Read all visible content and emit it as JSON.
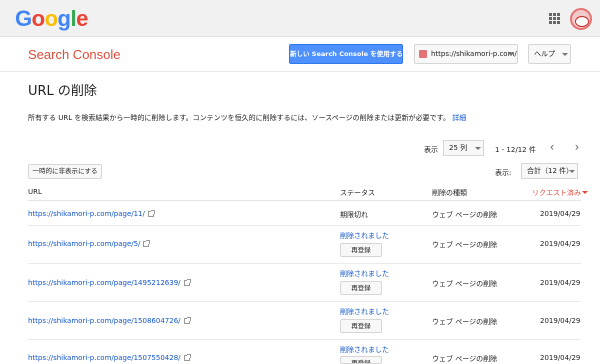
{
  "header": {
    "logo_letters": [
      "G",
      "o",
      "o",
      "g",
      "l",
      "e"
    ],
    "apps_icon": "apps-grid-icon",
    "avatar_icon": "user-avatar"
  },
  "brandbar": {
    "brand": "Search Console",
    "new_console_button": "新しい Search Console を使用する",
    "site": "https://shikamori-p.com/",
    "help": "ヘルプ"
  },
  "page": {
    "title": "URL の削除",
    "description": "所有する URL を検索結果から一時的に削除します。コンテンツを恒久的に削除するには、ソースページの削除または更新が必要です。",
    "details_link": "詳細"
  },
  "pager": {
    "label": "表示",
    "rows_value": "25 列",
    "range": "1 - 12/12 件",
    "prev_icon": "‹",
    "next_icon": "›"
  },
  "controls": {
    "hide_all_button": "一時的に非表示にする",
    "show_label": "表示:",
    "show_value": "合計（12 件）"
  },
  "table": {
    "headers": {
      "url": "URL",
      "status": "ステータス",
      "type": "削除の種類",
      "requested": "リクエスト済み"
    },
    "rows": [
      {
        "url": "https://shikamori-p.com/page/11/",
        "status": "期限切れ",
        "type": "ウェブ ページの削除",
        "date": "2019/04/29",
        "button": ""
      },
      {
        "url": "https://shikamori-p.com/page/5/",
        "status": "削除されました",
        "type": "ウェブ ページの削除",
        "date": "2019/04/29",
        "button": "再登録"
      },
      {
        "url": "https://shikamori-p.com/page/1495212639/",
        "status": "削除されました",
        "type": "ウェブ ページの削除",
        "date": "2019/04/29",
        "button": "再登録"
      },
      {
        "url": "https://shikamori-p.com/page/1508604726/",
        "status": "削除されました",
        "type": "ウェブ ページの削除",
        "date": "2019/04/29",
        "button": "再登録"
      },
      {
        "url": "https://shikamori-p.com/page/1507550428/",
        "status": "削除されました",
        "type": "ウェブ ページの削除",
        "date": "2019/04/29",
        "button": "再登録"
      }
    ]
  },
  "colors": {
    "brand_red": "#dd4b39",
    "link_blue": "#1155cc",
    "button_blue": "#4d90fe"
  }
}
